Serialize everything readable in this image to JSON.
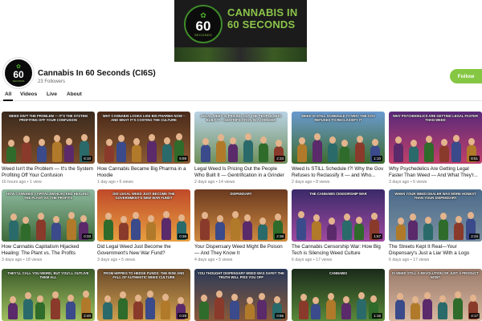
{
  "banner": {
    "logo_num": "60",
    "logo_sub": "SECONDS",
    "title": "CANNABIS IN 60 SECONDS"
  },
  "channel": {
    "avatar_num": "60",
    "avatar_sub": "SECONDS",
    "name": "Cannabis In 60 Seconds (CI6S)",
    "followers": "23 Followers",
    "follow_label": "Follow"
  },
  "tabs": [
    {
      "label": "All",
      "active": true
    },
    {
      "label": "Videos",
      "active": false
    },
    {
      "label": "Live",
      "active": false
    },
    {
      "label": "About",
      "active": false
    }
  ],
  "colors": {
    "accent": "#85c742",
    "banner_green": "#8bc34a"
  },
  "videos": [
    {
      "caption": "Weed isn't the problem — it's the system profiting off your confusion",
      "duration": "6:10",
      "title": "Weed Isn't the Problem — It's the System Profiting Off Your Confusion",
      "meta": "16 hours ago • 1 view",
      "bg": "#3b2a1e",
      "bg2": "#7a4d2a"
    },
    {
      "caption": "Why cannabis looks like big pharma now – and what it's costing the culture",
      "duration": "5:59",
      "title": "How Cannabis Became Big Pharma in a Hoodie",
      "meta": "1 day ago • 6 views",
      "bg": "#4a2a1a",
      "bg2": "#8c5a32"
    },
    {
      "caption": "Legal weed is pricing out the people who built it – gentrification in a grinder",
      "duration": "2:33",
      "title": "Legal Weed Is Pricing Out the People Who Built It — Gentrification in a Grinder",
      "meta": "2 days ago • 14 views",
      "bg": "#b9d3e6",
      "bg2": "#6f8f5a"
    },
    {
      "caption": "Weed is STILL Schedule I?! Why the Gov refuses to reclassify it",
      "duration": "1:10",
      "title": "Weed Is STILL Schedule I?! Why the Gov Refuses to Reclassify It — and Who...",
      "meta": "2 days ago • 8 views",
      "bg": "#6a9ad0",
      "bg2": "#3e6b2c"
    },
    {
      "caption": "Why psychedelics are getting legal faster than weed",
      "duration": "8:51",
      "title": "Why Psychedelics Are Getting Legal Faster Than Weed — And What They'r...",
      "meta": "3 days ago • 6 views",
      "bg": "#5a2a7a",
      "bg2": "#c0406a"
    },
    {
      "caption": "How cannabis capitalism hijacked healing: the plant vs. the profits",
      "duration": "0:33",
      "title": "How Cannabis Capitalism Hijacked Healing: The Plant vs. The Profits",
      "meta": "3 days ago • 18 views",
      "bg": "#8fb9a0",
      "bg2": "#3f6a3a"
    },
    {
      "caption": "Did legal weed just become the government's new war fund?",
      "duration": "0:36",
      "title": "Did Legal Weed Just Become the Government's New War Fund?",
      "meta": "3 days ago • 5 views",
      "bg": "#c04a2a",
      "bg2": "#e8a040"
    },
    {
      "caption": "Dispensary",
      "duration": "2:36",
      "title": "Your Dispensary Weed Might Be Poison — And They Know It",
      "meta": "4 days ago • 5 views",
      "bg": "#6a3a20",
      "bg2": "#d08a40"
    },
    {
      "caption": "The cannabis censorship war",
      "duration": "1:57",
      "title": "The Cannabis Censorship War: How Big Tech is Silencing Weed Culture",
      "meta": "6 days ago • 17 views",
      "bg": "#3a2a6a",
      "bg2": "#a04aa0"
    },
    {
      "caption": "When your weed dealer was more honest than your dispensary",
      "duration": "2:24",
      "title": "The Streets Kept It Real—Your Dispensary's Just a Liar With a Logo",
      "meta": "6 days ago • 17 views",
      "bg": "#4a6a8a",
      "bg2": "#7a8fa0"
    },
    {
      "caption": "They'll call you weird, but you'll outlive them all",
      "duration": "2:40",
      "title": "",
      "meta": "",
      "bg": "#3a5a2a",
      "bg2": "#a0c060"
    },
    {
      "caption": "From hippies to hedge funds: the rise and fall of authentic weed culture",
      "duration": "0:29",
      "title": "",
      "meta": "",
      "bg": "#6a4a2a",
      "bg2": "#d0a050"
    },
    {
      "caption": "You thought dispensary weed was safe? The truth will piss you off",
      "duration": "0:55",
      "title": "",
      "meta": "",
      "bg": "#2a3a5a",
      "bg2": "#8a5a3a"
    },
    {
      "caption": "Cannabis",
      "duration": "1:16",
      "title": "",
      "meta": "",
      "bg": "#1a2a1a",
      "bg2": "#5a8a3a"
    },
    {
      "caption": "Is weed still a revolution or just a product now?",
      "duration": "4:17",
      "title": "",
      "meta": "",
      "bg": "#9a7a6a",
      "bg2": "#d8b8a0"
    }
  ]
}
